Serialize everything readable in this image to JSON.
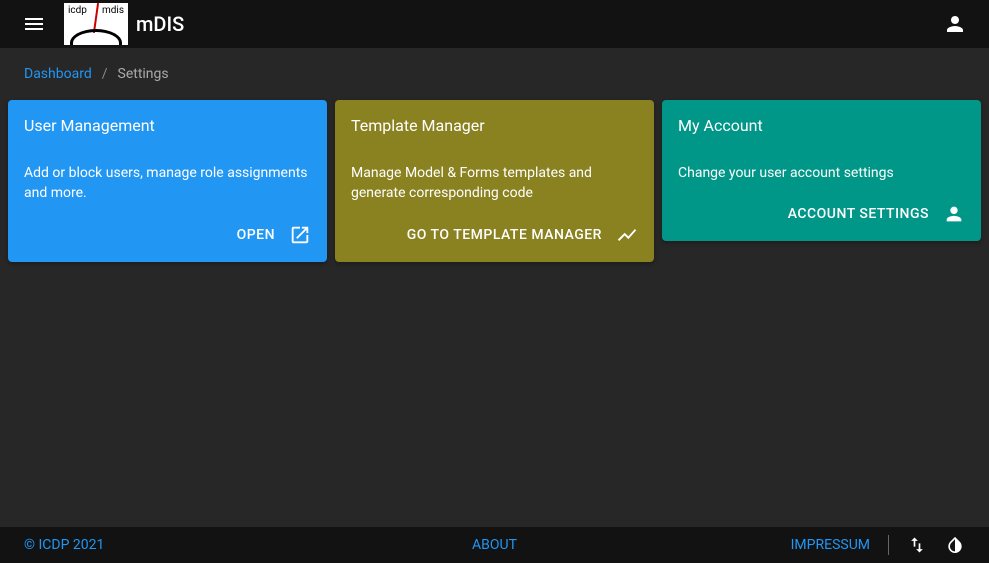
{
  "app": {
    "title": "mDIS"
  },
  "breadcrumbs": {
    "dashboard": "Dashboard",
    "separator": "/",
    "current": "Settings"
  },
  "cards": {
    "user_mgmt": {
      "title": "User Management",
      "desc": "Add or block users, manage role assignments and more.",
      "action": "OPEN"
    },
    "template_mgr": {
      "title": "Template Manager",
      "desc": "Manage Model & Forms templates and generate corresponding code",
      "action": "GO TO TEMPLATE MANAGER"
    },
    "my_account": {
      "title": "My Account",
      "desc": "Change your user account settings",
      "action": "ACCOUNT SETTINGS"
    }
  },
  "footer": {
    "copyright": "© ICDP 2021",
    "about": "ABOUT",
    "impressum": "IMPRESSUM"
  }
}
